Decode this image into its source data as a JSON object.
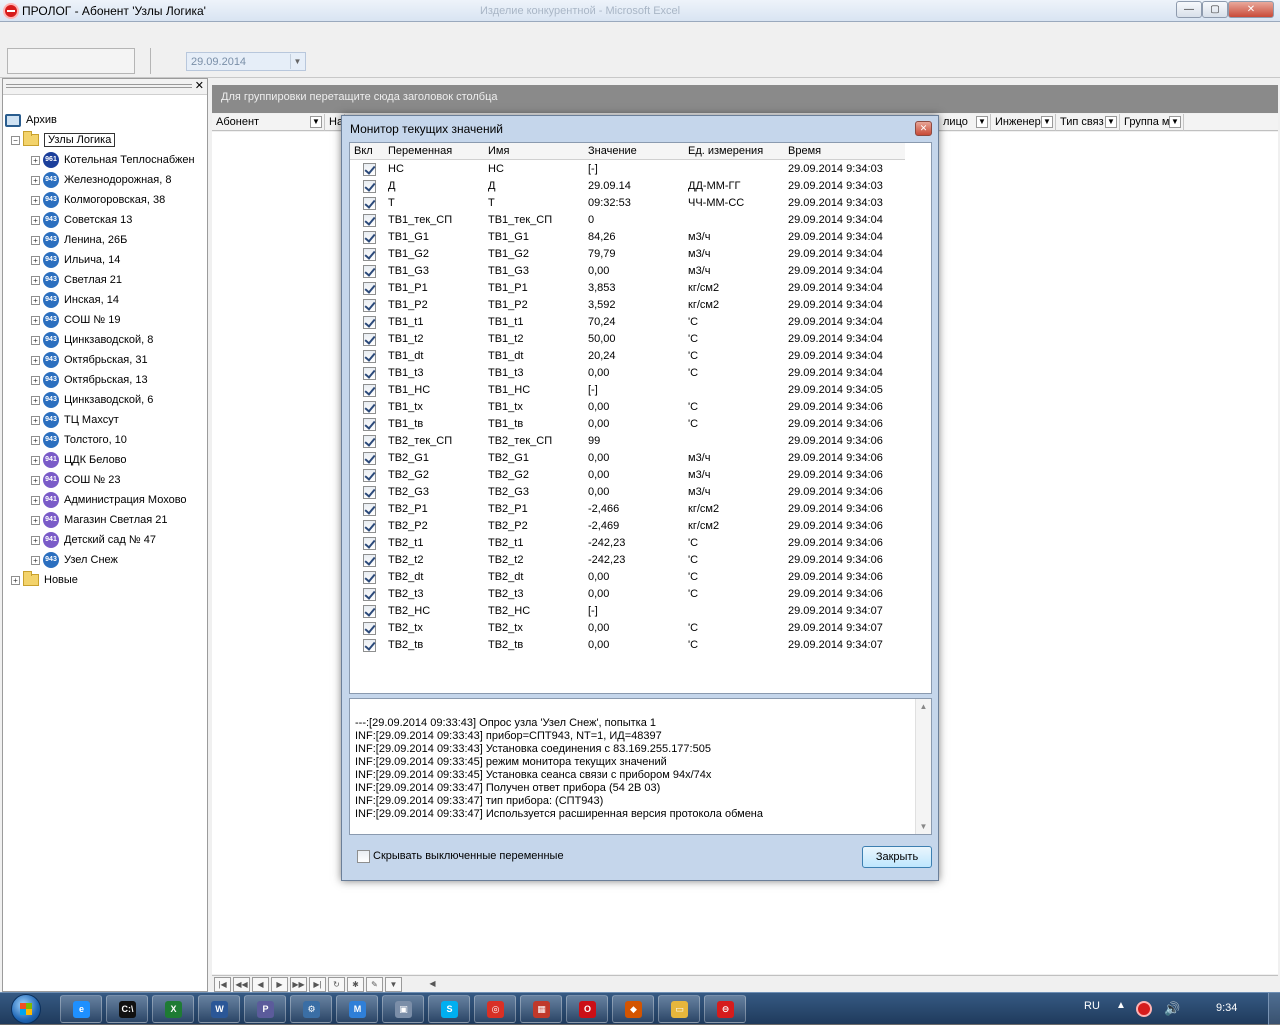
{
  "window": {
    "title": "ПРОЛОГ - Абонент 'Узлы Логика'",
    "background_title": "Изделие конкурентной - Microsoft Excel"
  },
  "toolbar": {
    "date_value": "29.09.2014"
  },
  "tree": {
    "archive_label": "Архив",
    "root_label": "Узлы Логика",
    "new_label": "Новые",
    "nodes": [
      {
        "badge": "961",
        "label": "Котельная  Теплоснабжен"
      },
      {
        "badge": "943",
        "label": "Железнодорожная, 8"
      },
      {
        "badge": "943",
        "label": "Колмогоровская, 38"
      },
      {
        "badge": "943",
        "label": "Советская 13"
      },
      {
        "badge": "943",
        "label": "Ленина, 26Б"
      },
      {
        "badge": "943",
        "label": "Ильича, 14"
      },
      {
        "badge": "943",
        "label": "Светлая 21"
      },
      {
        "badge": "943",
        "label": "Инская, 14"
      },
      {
        "badge": "943",
        "label": "СОШ № 19"
      },
      {
        "badge": "943",
        "label": "Цинкзаводской, 8"
      },
      {
        "badge": "943",
        "label": "Октябрьская, 31"
      },
      {
        "badge": "943",
        "label": "Октябрьская, 13"
      },
      {
        "badge": "943",
        "label": "Цинкзаводской, 6"
      },
      {
        "badge": "943",
        "label": "ТЦ Махсут"
      },
      {
        "badge": "943",
        "label": "Толстого, 10"
      },
      {
        "badge": "941",
        "label": "ЦДК Белово"
      },
      {
        "badge": "941",
        "label": "СОШ № 23"
      },
      {
        "badge": "941",
        "label": "Администрация Мохово"
      },
      {
        "badge": "941",
        "label": "Магазин Светлая 21"
      },
      {
        "badge": "941",
        "label": "Детский сад № 47"
      },
      {
        "badge": "943",
        "label": "Узел Снеж"
      }
    ]
  },
  "grid": {
    "group_hint": "Для группировки перетащите сюда заголовок столбца",
    "columns": [
      "Абонент",
      "На",
      "лицо",
      "Инженер",
      "Тип связ",
      "Группа м"
    ]
  },
  "dialog": {
    "title": "Монитор текущих значений",
    "headers": [
      "Вкл",
      "Переменная",
      "Имя",
      "Значение",
      "Ед. измерения",
      "Время"
    ],
    "rows": [
      {
        "var": "НС",
        "name": "НС",
        "value": "[-]",
        "unit": "",
        "time": "29.09.2014 9:34:03"
      },
      {
        "var": "Д",
        "name": "Д",
        "value": "29.09.14",
        "unit": "ДД-ММ-ГГ",
        "time": "29.09.2014 9:34:03"
      },
      {
        "var": "Т",
        "name": "Т",
        "value": "09:32:53",
        "unit": "ЧЧ-ММ-СС",
        "time": "29.09.2014 9:34:03"
      },
      {
        "var": "ТВ1_тек_СП",
        "name": "ТВ1_тек_СП",
        "value": "0",
        "unit": "",
        "time": "29.09.2014 9:34:04"
      },
      {
        "var": "ТВ1_G1",
        "name": "ТВ1_G1",
        "value": "84,26",
        "unit": "м3/ч",
        "time": "29.09.2014 9:34:04"
      },
      {
        "var": "ТВ1_G2",
        "name": "ТВ1_G2",
        "value": "79,79",
        "unit": "м3/ч",
        "time": "29.09.2014 9:34:04"
      },
      {
        "var": "ТВ1_G3",
        "name": "ТВ1_G3",
        "value": "0,00",
        "unit": "м3/ч",
        "time": "29.09.2014 9:34:04"
      },
      {
        "var": "ТВ1_P1",
        "name": "ТВ1_P1",
        "value": "3,853",
        "unit": "кг/см2",
        "time": "29.09.2014 9:34:04"
      },
      {
        "var": "ТВ1_P2",
        "name": "ТВ1_P2",
        "value": "3,592",
        "unit": "кг/см2",
        "time": "29.09.2014 9:34:04"
      },
      {
        "var": "ТВ1_t1",
        "name": "ТВ1_t1",
        "value": "70,24",
        "unit": "'С",
        "time": "29.09.2014 9:34:04"
      },
      {
        "var": "ТВ1_t2",
        "name": "ТВ1_t2",
        "value": "50,00",
        "unit": "'С",
        "time": "29.09.2014 9:34:04"
      },
      {
        "var": "ТВ1_dt",
        "name": "ТВ1_dt",
        "value": "20,24",
        "unit": "'С",
        "time": "29.09.2014 9:34:04"
      },
      {
        "var": "ТВ1_t3",
        "name": "ТВ1_t3",
        "value": "0,00",
        "unit": "'С",
        "time": "29.09.2014 9:34:04"
      },
      {
        "var": "ТВ1_НС",
        "name": "ТВ1_НС",
        "value": "[-]",
        "unit": "",
        "time": "29.09.2014 9:34:05"
      },
      {
        "var": "ТВ1_tх",
        "name": "ТВ1_tх",
        "value": "0,00",
        "unit": "'С",
        "time": "29.09.2014 9:34:06"
      },
      {
        "var": "ТВ1_tв",
        "name": "ТВ1_tв",
        "value": "0,00",
        "unit": "'С",
        "time": "29.09.2014 9:34:06"
      },
      {
        "var": "ТВ2_тек_СП",
        "name": "ТВ2_тек_СП",
        "value": "99",
        "unit": "",
        "time": "29.09.2014 9:34:06"
      },
      {
        "var": "ТВ2_G1",
        "name": "ТВ2_G1",
        "value": "0,00",
        "unit": "м3/ч",
        "time": "29.09.2014 9:34:06"
      },
      {
        "var": "ТВ2_G2",
        "name": "ТВ2_G2",
        "value": "0,00",
        "unit": "м3/ч",
        "time": "29.09.2014 9:34:06"
      },
      {
        "var": "ТВ2_G3",
        "name": "ТВ2_G3",
        "value": "0,00",
        "unit": "м3/ч",
        "time": "29.09.2014 9:34:06"
      },
      {
        "var": "ТВ2_P1",
        "name": "ТВ2_P1",
        "value": "-2,466",
        "unit": "кг/см2",
        "time": "29.09.2014 9:34:06"
      },
      {
        "var": "ТВ2_P2",
        "name": "ТВ2_P2",
        "value": "-2,469",
        "unit": "кг/см2",
        "time": "29.09.2014 9:34:06"
      },
      {
        "var": "ТВ2_t1",
        "name": "ТВ2_t1",
        "value": "-242,23",
        "unit": "'С",
        "time": "29.09.2014 9:34:06"
      },
      {
        "var": "ТВ2_t2",
        "name": "ТВ2_t2",
        "value": "-242,23",
        "unit": "'С",
        "time": "29.09.2014 9:34:06"
      },
      {
        "var": "ТВ2_dt",
        "name": "ТВ2_dt",
        "value": "0,00",
        "unit": "'С",
        "time": "29.09.2014 9:34:06"
      },
      {
        "var": "ТВ2_t3",
        "name": "ТВ2_t3",
        "value": "0,00",
        "unit": "'С",
        "time": "29.09.2014 9:34:06"
      },
      {
        "var": "ТВ2_НС",
        "name": "ТВ2_НС",
        "value": "[-]",
        "unit": "",
        "time": "29.09.2014 9:34:07"
      },
      {
        "var": "ТВ2_tх",
        "name": "ТВ2_tх",
        "value": "0,00",
        "unit": "'С",
        "time": "29.09.2014 9:34:07"
      },
      {
        "var": "ТВ2_tв",
        "name": "ТВ2_tв",
        "value": "0,00",
        "unit": "'С",
        "time": "29.09.2014 9:34:07"
      }
    ],
    "log": [
      "---:[29.09.2014 09:33:43] Опрос узла 'Узел Снеж', попытка 1",
      "INF:[29.09.2014 09:33:43] прибор=СПТ943, NT=1, ИД=48397",
      "INF:[29.09.2014 09:33:43] Установка соединения с 83.169.255.177:505",
      "INF:[29.09.2014 09:33:45] режим монитора текущих значений",
      "INF:[29.09.2014 09:33:45] Установка сеанса связи с прибором 94х/74х",
      "INF:[29.09.2014 09:33:47] Получен ответ прибора (54 2B 03)",
      "INF:[29.09.2014 09:33:47] тип прибора: (СПТ943)",
      "INF:[29.09.2014 09:33:47] Используется расширенная версия протокола обмена"
    ],
    "hide_disabled_label": "Скрывать выключенные переменные",
    "close_label": "Закрыть"
  },
  "taskbar": {
    "language": "RU",
    "clock": "9:34",
    "apps": [
      {
        "icon": "ie-icon",
        "letter": "e",
        "color": "#1e90ff"
      },
      {
        "icon": "cmd-icon",
        "letter": "C:\\",
        "color": "#111111"
      },
      {
        "icon": "excel-icon",
        "letter": "X",
        "color": "#1e7b34"
      },
      {
        "icon": "word-icon",
        "letter": "W",
        "color": "#2b5797"
      },
      {
        "icon": "publisher-icon",
        "letter": "P",
        "color": "#5b5b9b"
      },
      {
        "icon": "network-icon",
        "letter": "⚙",
        "color": "#3a6ea5"
      },
      {
        "icon": "m-app-icon",
        "letter": "M",
        "color": "#2f7fd8"
      },
      {
        "icon": "window-app-icon",
        "letter": "▣",
        "color": "#7b8ea8"
      },
      {
        "icon": "skype-icon",
        "letter": "S",
        "color": "#00aff0"
      },
      {
        "icon": "chrome-icon",
        "letter": "◎",
        "color": "#d93025"
      },
      {
        "icon": "archive-app-icon",
        "letter": "▦",
        "color": "#c0392b"
      },
      {
        "icon": "opera-icon",
        "letter": "O",
        "color": "#cc0f16"
      },
      {
        "icon": "installer-icon",
        "letter": "◆",
        "color": "#d35400"
      },
      {
        "icon": "explorer-icon",
        "letter": "▭",
        "color": "#e7b63c"
      },
      {
        "icon": "prolog-icon",
        "letter": "⊖",
        "color": "#d61c1c"
      }
    ]
  }
}
